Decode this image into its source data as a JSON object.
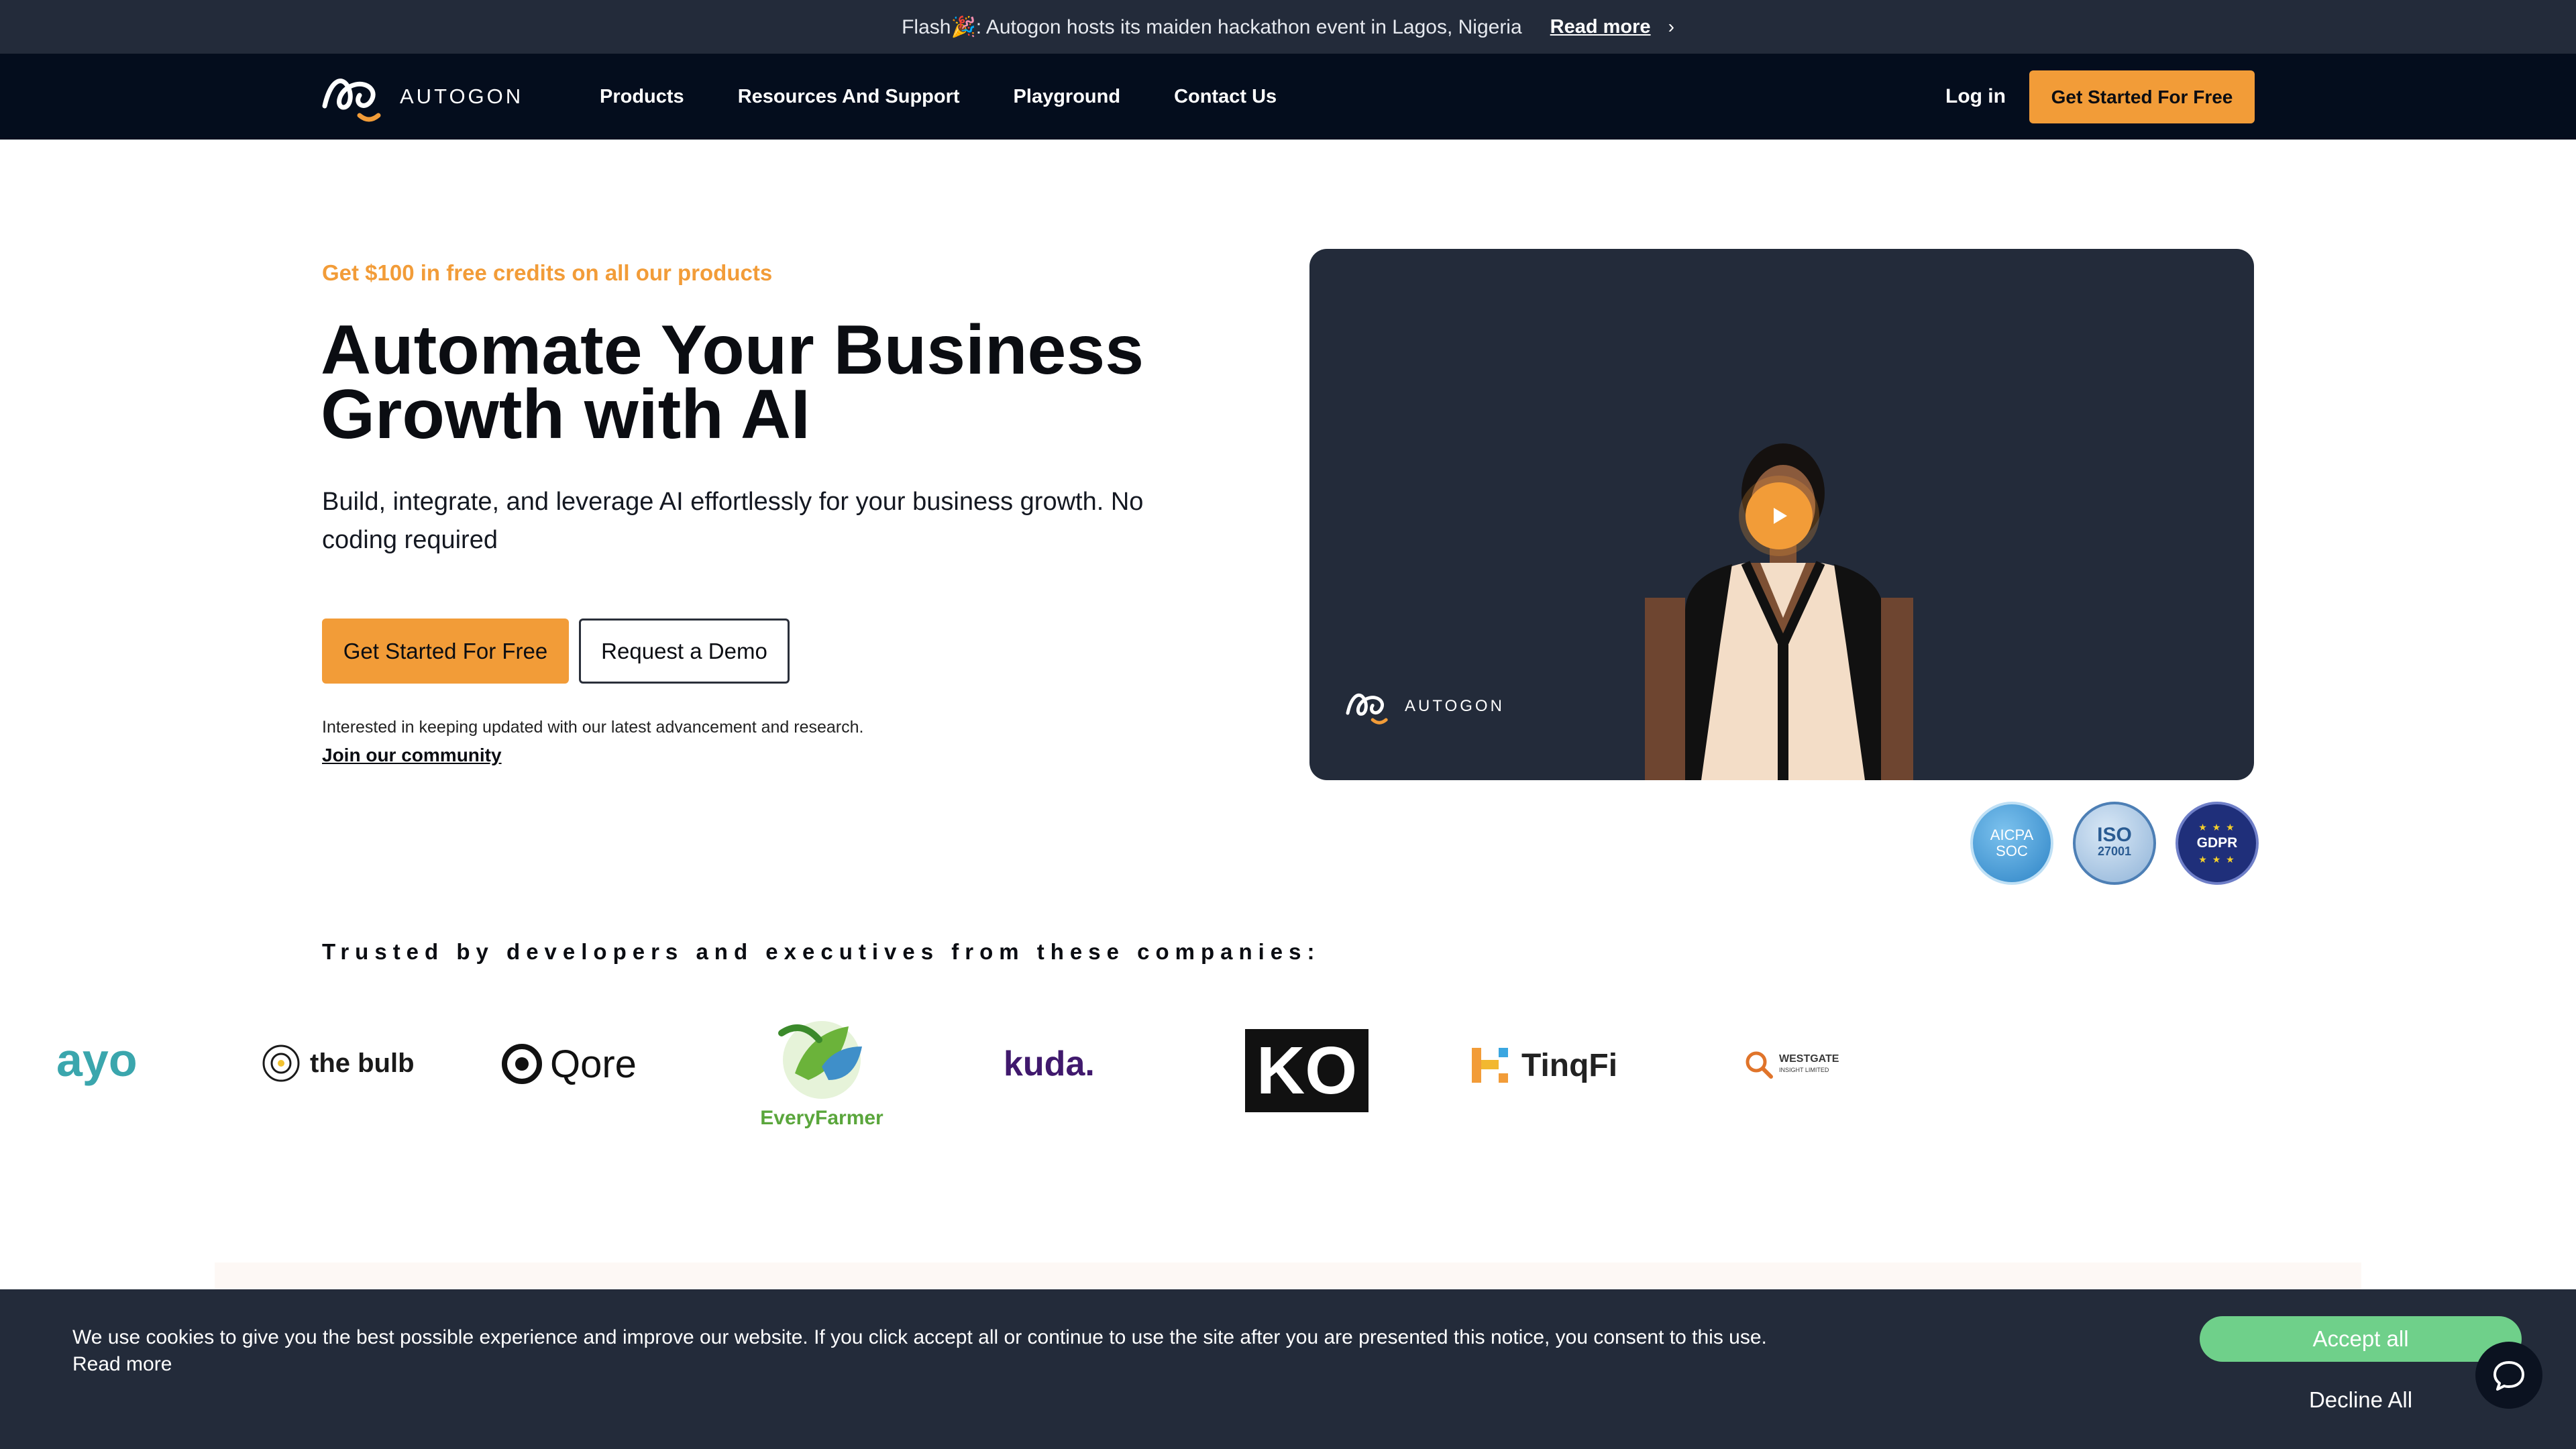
{
  "flash": {
    "message": "Flash🎉: Autogon hosts its maiden hackathon event in Lagos, Nigeria",
    "link": "Read more",
    "chevron": "›"
  },
  "nav": {
    "brand": "AUTOGON",
    "links": [
      "Products",
      "Resources And Support",
      "Playground",
      "Contact Us"
    ],
    "login": "Log in",
    "cta": "Get Started For Free"
  },
  "hero": {
    "promo": "Get $100 in free credits on all our products",
    "headline_line1": "Automate Your Business",
    "headline_line2": "Growth with AI",
    "subtitle": "Build, integrate, and leverage AI effortlessly for your business growth. No coding required",
    "primary_cta": "Get Started For Free",
    "secondary_cta": "Request a Demo",
    "interest_text": "Interested in keeping updated with our latest advancement and research.",
    "community_link": "Join our community"
  },
  "video": {
    "brand": "AUTOGON"
  },
  "badges": {
    "soc_line1": "AICPA",
    "soc_line2": "SOC",
    "iso_line1": "ISO",
    "iso_line2": "27001",
    "gdpr": "GDPR"
  },
  "trusted": {
    "heading": "Trusted by developers and executives from these companies:",
    "companies": [
      "ayo",
      "the bulb",
      "Qore",
      "EveryFarmer",
      "kuda.",
      "KO",
      "TinqFi",
      "WESTGATE"
    ],
    "westgate_sub": "INSIGHT LIMITED"
  },
  "cookie": {
    "text": "We use cookies to give you the best possible experience and improve our website. If you click accept all or continue to use the site after you are presented this notice, you consent to this use. Read more",
    "accept": "Accept all",
    "decline": "Decline All"
  },
  "colors": {
    "accent": "#f29c38",
    "nav_bg": "#040d1d",
    "banner_bg": "#232b3a",
    "accept_green": "#6fd08a"
  }
}
